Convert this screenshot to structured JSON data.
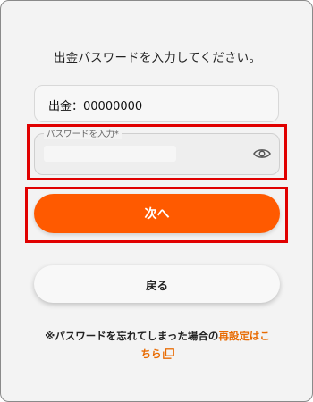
{
  "instruction": "出金パスワードを入力してください。",
  "amount_field": {
    "value": "出金：00000000"
  },
  "password_field": {
    "label": "パスワードを入力*",
    "value": "",
    "eye_icon": "eye-icon"
  },
  "buttons": {
    "next_label": "次へ",
    "back_label": "戻る"
  },
  "forgot_note": {
    "text": "※パスワードを忘れてしまった場合の",
    "link_line1": "再設定はこ",
    "link_line2": "ちら",
    "link_icon": "external-link-icon"
  },
  "colors": {
    "accent": "#ff5a00",
    "link": "#e86a00",
    "highlight": "#e00000"
  }
}
